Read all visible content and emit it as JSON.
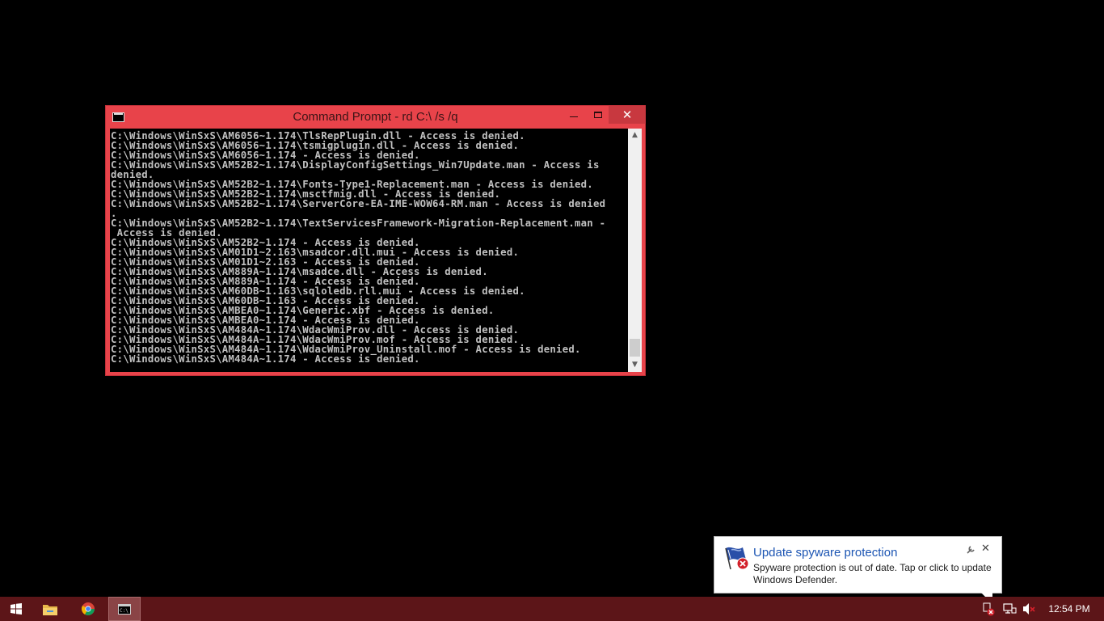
{
  "cmd_window": {
    "title": "Command Prompt - rd  C:\\ /s /q",
    "minimize_label": "",
    "maximize_label": "",
    "close_label": "✕",
    "lines": [
      "C:\\Windows\\WinSxS\\AM6056~1.174\\TlsRepPlugin.dll - Access is denied.",
      "C:\\Windows\\WinSxS\\AM6056~1.174\\tsmigplugin.dll - Access is denied.",
      "C:\\Windows\\WinSxS\\AM6056~1.174 - Access is denied.",
      "C:\\Windows\\WinSxS\\AM52B2~1.174\\DisplayConfigSettings_Win7Update.man - Access is",
      "denied.",
      "C:\\Windows\\WinSxS\\AM52B2~1.174\\Fonts-Type1-Replacement.man - Access is denied.",
      "C:\\Windows\\WinSxS\\AM52B2~1.174\\msctfmig.dll - Access is denied.",
      "C:\\Windows\\WinSxS\\AM52B2~1.174\\ServerCore-EA-IME-WOW64-RM.man - Access is denied",
      ".",
      "C:\\Windows\\WinSxS\\AM52B2~1.174\\TextServicesFramework-Migration-Replacement.man -",
      " Access is denied.",
      "C:\\Windows\\WinSxS\\AM52B2~1.174 - Access is denied.",
      "C:\\Windows\\WinSxS\\AM01D1~2.163\\msadcor.dll.mui - Access is denied.",
      "C:\\Windows\\WinSxS\\AM01D1~2.163 - Access is denied.",
      "C:\\Windows\\WinSxS\\AM889A~1.174\\msadce.dll - Access is denied.",
      "C:\\Windows\\WinSxS\\AM889A~1.174 - Access is denied.",
      "C:\\Windows\\WinSxS\\AM60DB~1.163\\sqloledb.rll.mui - Access is denied.",
      "C:\\Windows\\WinSxS\\AM60DB~1.163 - Access is denied.",
      "C:\\Windows\\WinSxS\\AMBEA0~1.174\\Generic.xbf - Access is denied.",
      "C:\\Windows\\WinSxS\\AMBEA0~1.174 - Access is denied.",
      "C:\\Windows\\WinSxS\\AM484A~1.174\\WdacWmiProv.dll - Access is denied.",
      "C:\\Windows\\WinSxS\\AM484A~1.174\\WdacWmiProv.mof - Access is denied.",
      "C:\\Windows\\WinSxS\\AM484A~1.174\\WdacWmiProv_Uninstall.mof - Access is denied.",
      "C:\\Windows\\WinSxS\\AM484A~1.174 - Access is denied."
    ]
  },
  "notification": {
    "title": "Update spyware protection",
    "text": "Spyware protection is out of date. Tap or click to update Windows Defender.",
    "icon": "windows-defender-warning-icon"
  },
  "taskbar": {
    "items": [
      {
        "name": "start-button",
        "icon": "windows-logo-icon"
      },
      {
        "name": "file-explorer-button",
        "icon": "folder-icon"
      },
      {
        "name": "chrome-button",
        "icon": "chrome-icon"
      },
      {
        "name": "command-prompt-button",
        "icon": "cmd-icon",
        "active": true
      }
    ],
    "tray": [
      "action-center-warning-icon",
      "network-icon",
      "volume-muted-icon"
    ],
    "clock": "12:54 PM"
  },
  "colors": {
    "window_frame": "#e8434a",
    "console_bg": "#000000",
    "console_text": "#c0c0c0",
    "taskbar": "#5c1518",
    "notification_title": "#1c55b3"
  }
}
